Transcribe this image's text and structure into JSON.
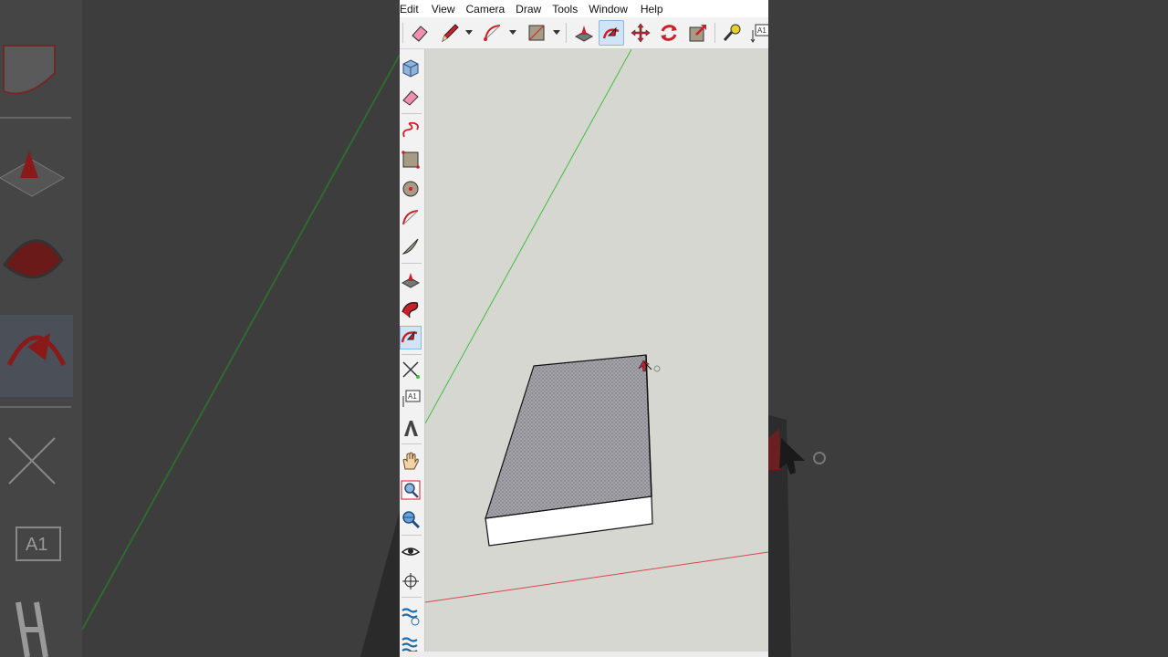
{
  "menu": {
    "items": [
      "Edit",
      "View",
      "Camera",
      "Draw",
      "Tools",
      "Window",
      "Help"
    ]
  },
  "toolbar": {
    "tools": [
      {
        "name": "eraser-tool",
        "icon": "eraser-icon"
      },
      {
        "name": "pencil-tool",
        "icon": "pencil-icon",
        "has_dropdown": true
      },
      {
        "name": "arc-tool",
        "icon": "arc-icon",
        "has_dropdown": true
      },
      {
        "name": "rectangle-tool",
        "icon": "rectangle-icon",
        "has_dropdown": true
      },
      {
        "name": "push-pull-tool",
        "icon": "push-pull-icon"
      },
      {
        "name": "follow-me-tool",
        "icon": "follow-me-icon",
        "active": true
      },
      {
        "name": "move-tool",
        "icon": "move-icon"
      },
      {
        "name": "rotate-tool",
        "icon": "rotate-icon"
      },
      {
        "name": "scale-tool",
        "icon": "scale-icon"
      },
      {
        "name": "tape-measure-tool",
        "icon": "tape-measure-icon"
      },
      {
        "name": "text-tool",
        "icon": "text-icon",
        "label": "A1"
      }
    ]
  },
  "sidebar": {
    "text_tool_label": "A1",
    "active_tool": "follow-me-tool"
  },
  "colors": {
    "viewport_bg": "#d7d7d2",
    "green_axis": "#3fbf3f",
    "red_axis": "#d44a4a",
    "face_gray": "#9a9aa0",
    "accent_red": "#cc1f2a",
    "active_bg": "#cfe4f7"
  }
}
